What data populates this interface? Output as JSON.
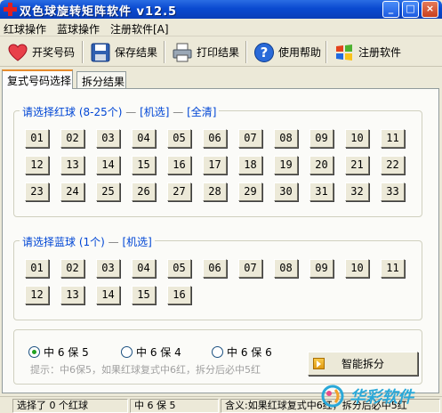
{
  "window": {
    "title": "双色球旋转矩阵软件 v12.5",
    "minimize": "_",
    "maximize": "□",
    "close": "×"
  },
  "menu": [
    "红球操作",
    "蓝球操作",
    "注册软件[A]"
  ],
  "toolbar": {
    "open_numbers": "开奖号码",
    "save_results": "保存结果",
    "print_results": "打印结果",
    "help": "使用帮助",
    "register": "注册软件"
  },
  "tabs": [
    "复式号码选择",
    "拆分结果"
  ],
  "red_group": {
    "label": "请选择红球 (8-25个)",
    "random": "[机选]",
    "clear": "[全清]",
    "balls": [
      "01",
      "02",
      "03",
      "04",
      "05",
      "06",
      "07",
      "08",
      "09",
      "10",
      "11",
      "12",
      "13",
      "14",
      "15",
      "16",
      "17",
      "18",
      "19",
      "20",
      "21",
      "22",
      "23",
      "24",
      "25",
      "26",
      "27",
      "28",
      "29",
      "30",
      "31",
      "32",
      "33"
    ]
  },
  "blue_group": {
    "label": "请选择蓝球 (1个)",
    "random": "[机选]",
    "balls": [
      "01",
      "02",
      "03",
      "04",
      "05",
      "06",
      "07",
      "08",
      "09",
      "10",
      "11",
      "12",
      "13",
      "14",
      "15",
      "16"
    ]
  },
  "options": {
    "items": [
      "中 6 保 5",
      "中 6 保 4",
      "中 6 保 6"
    ],
    "selected": 0,
    "hint": "提示：中6保5，如果红球复式中6红，拆分后必中5红",
    "split_button": "智能拆分"
  },
  "status": {
    "selected": "选择了 0 个红球",
    "mode": "中 6 保 5",
    "meaning": "含义:如果红球复式中6红，拆分后必中5红"
  },
  "watermark": "华彩软件",
  "colors": {
    "link": "#0046d5",
    "titlebar": "#0a4ad0",
    "accent_tab": "#e68b2c"
  }
}
